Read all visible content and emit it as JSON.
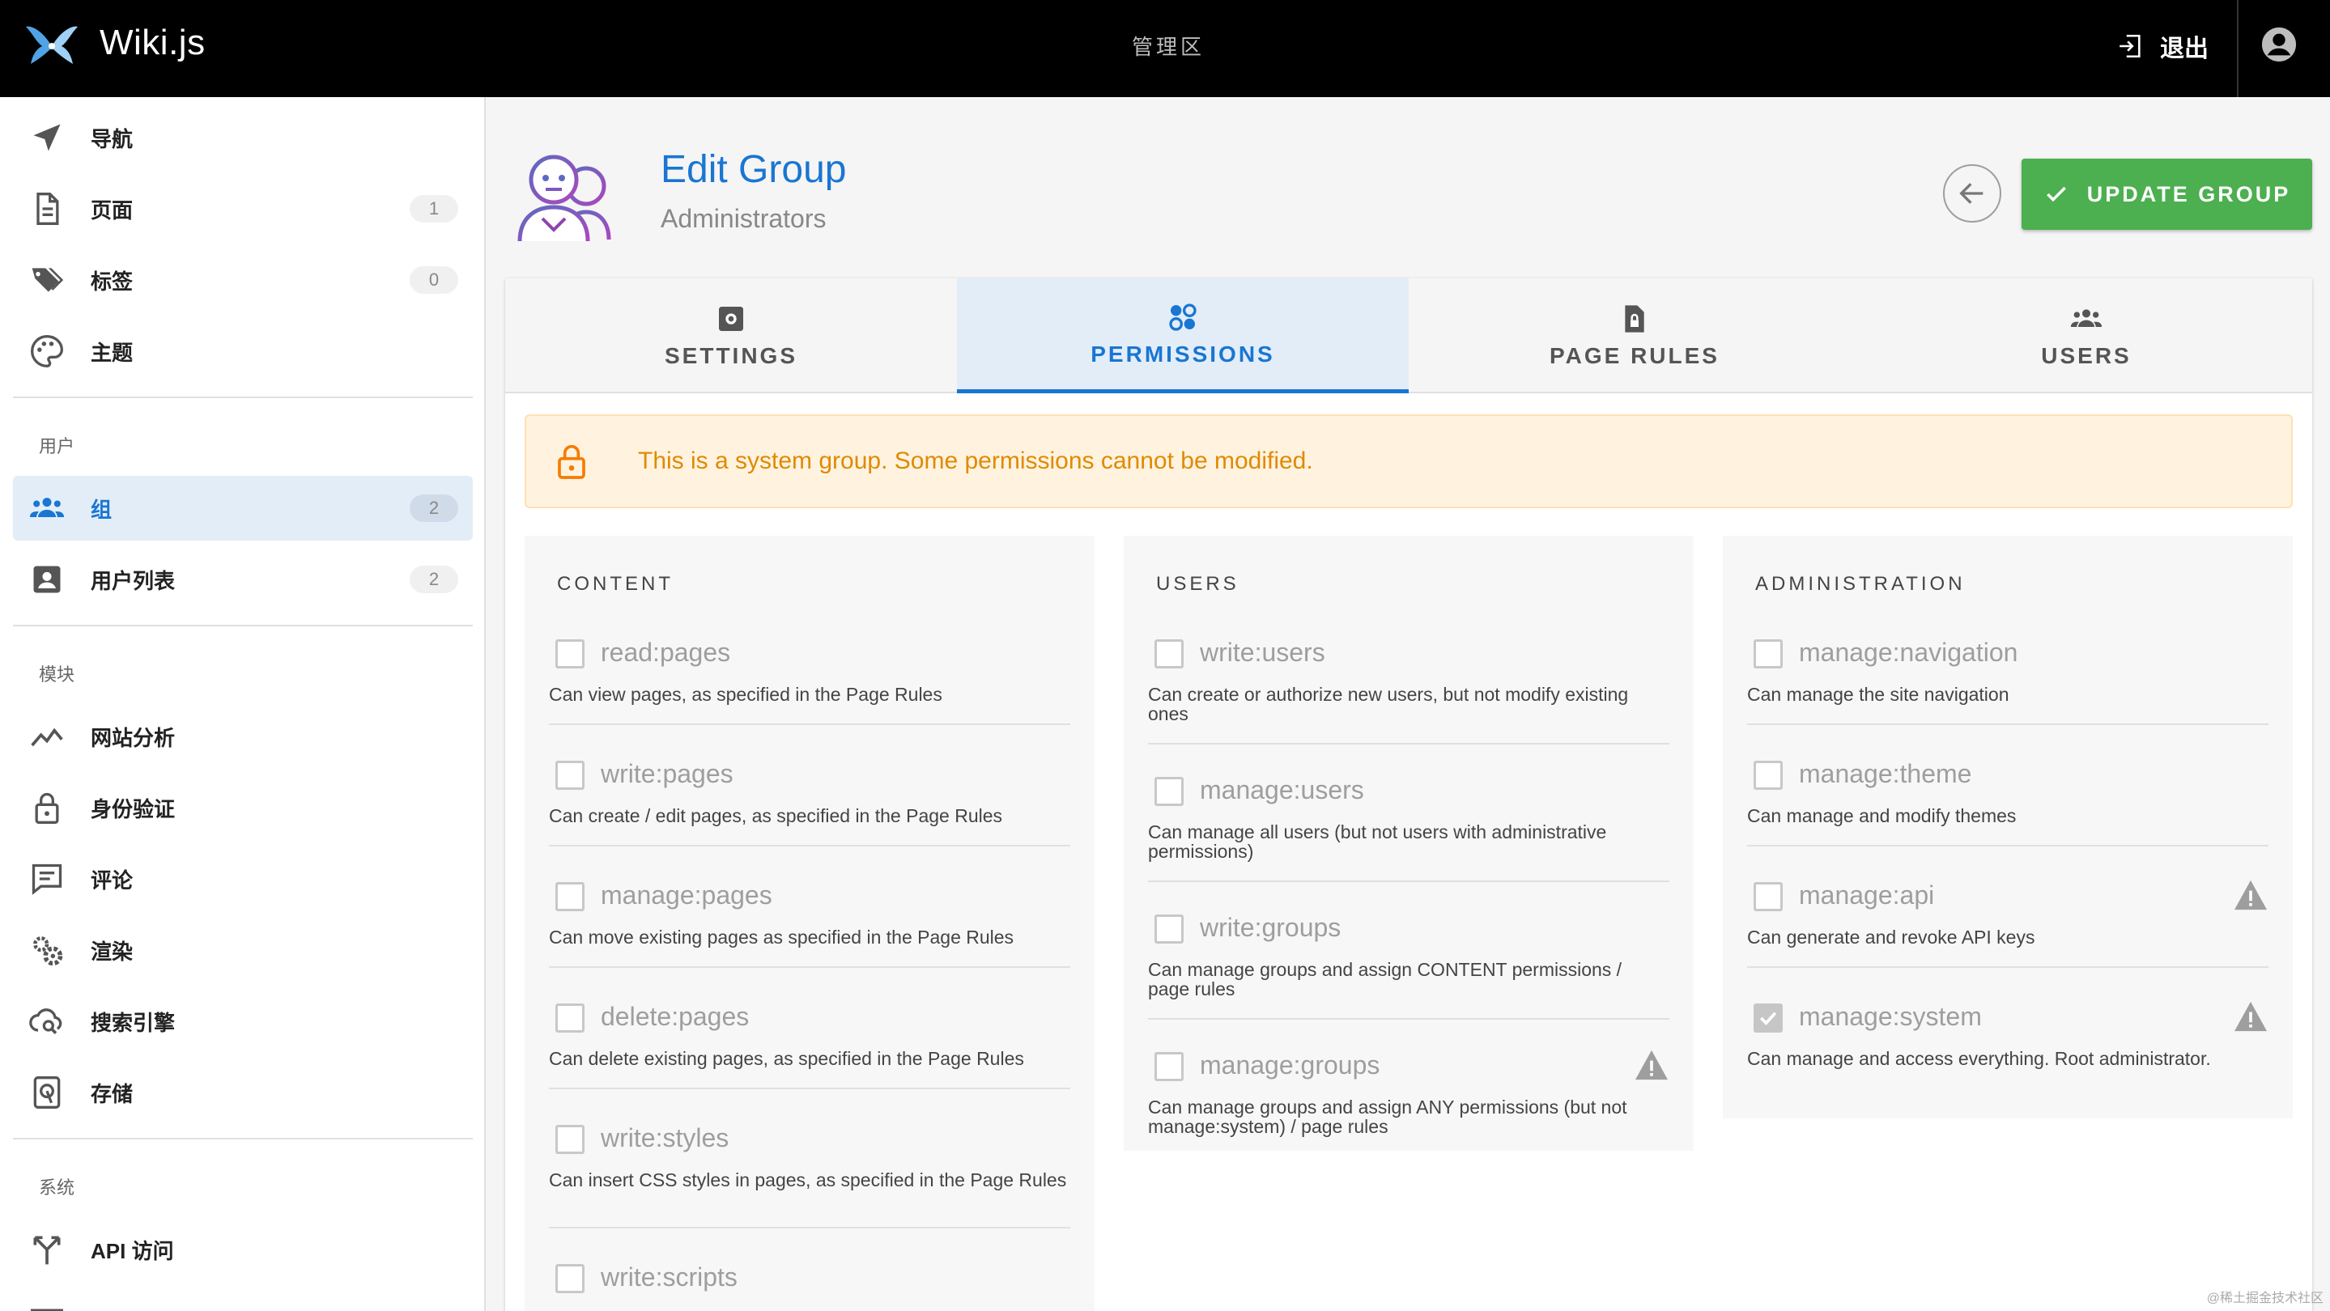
{
  "topbar": {
    "brand": "Wiki.js",
    "center": "管理区",
    "logout_label": "退出"
  },
  "sidebar": {
    "items_top": [
      {
        "label": "导航",
        "icon": "navigation-icon"
      },
      {
        "label": "页面",
        "icon": "file-icon",
        "badge": "1"
      },
      {
        "label": "标签",
        "icon": "tags-icon",
        "badge": "0"
      },
      {
        "label": "主题",
        "icon": "palette-icon"
      }
    ],
    "users_header": "用户",
    "users_items": [
      {
        "label": "组",
        "icon": "group-icon",
        "badge": "2",
        "active": true
      },
      {
        "label": "用户列表",
        "icon": "account-box-icon",
        "badge": "2"
      }
    ],
    "modules_header": "模块",
    "modules_items": [
      {
        "label": "网站分析",
        "icon": "analytics-icon"
      },
      {
        "label": "身份验证",
        "icon": "lock-icon"
      },
      {
        "label": "评论",
        "icon": "comment-icon"
      },
      {
        "label": "渲染",
        "icon": "cogs-icon"
      },
      {
        "label": "搜索引擎",
        "icon": "cloud-search-icon"
      },
      {
        "label": "存储",
        "icon": "storage-icon"
      }
    ],
    "system_header": "系统",
    "system_items": [
      {
        "label": "API 访问",
        "icon": "api-icon"
      }
    ]
  },
  "header": {
    "title": "Edit Group",
    "subtitle": "Administrators",
    "update_label": "UPDATE GROUP"
  },
  "tabs": [
    {
      "label": "SETTINGS",
      "icon": "settings-icon",
      "active": false
    },
    {
      "label": "PERMISSIONS",
      "icon": "permissions-icon",
      "active": true
    },
    {
      "label": "PAGE RULES",
      "icon": "page-lock-icon",
      "active": false
    },
    {
      "label": "USERS",
      "icon": "users-icon",
      "active": false
    }
  ],
  "alert": {
    "text": "This is a system group. Some permissions cannot be modified."
  },
  "columns": [
    {
      "title": "CONTENT",
      "perms": [
        {
          "name": "read:pages",
          "desc": "Can view pages, as specified in the Page Rules",
          "checked": false,
          "warn": false
        },
        {
          "name": "write:pages",
          "desc": "Can create / edit pages, as specified in the Page Rules",
          "checked": false,
          "warn": false
        },
        {
          "name": "manage:pages",
          "desc": "Can move existing pages as specified in the Page Rules",
          "checked": false,
          "warn": false
        },
        {
          "name": "delete:pages",
          "desc": "Can delete existing pages, as specified in the Page Rules",
          "checked": false,
          "warn": false
        },
        {
          "name": "write:styles",
          "desc": "Can insert CSS styles in pages, as specified in the Page Rules",
          "checked": false,
          "warn": false
        },
        {
          "name": "write:scripts",
          "desc": "",
          "checked": false,
          "warn": false
        }
      ]
    },
    {
      "title": "USERS",
      "perms": [
        {
          "name": "write:users",
          "desc": "Can create or authorize new users, but not modify existing ones",
          "checked": false,
          "warn": false
        },
        {
          "name": "manage:users",
          "desc": "Can manage all users (but not users with administrative permissions)",
          "checked": false,
          "warn": false
        },
        {
          "name": "write:groups",
          "desc": "Can manage groups and assign CONTENT permissions / page rules",
          "checked": false,
          "warn": false
        },
        {
          "name": "manage:groups",
          "desc": "Can manage groups and assign ANY permissions (but not manage:system) / page rules",
          "checked": false,
          "warn": true
        }
      ]
    },
    {
      "title": "ADMINISTRATION",
      "perms": [
        {
          "name": "manage:navigation",
          "desc": "Can manage the site navigation",
          "checked": false,
          "warn": false
        },
        {
          "name": "manage:theme",
          "desc": "Can manage and modify themes",
          "checked": false,
          "warn": false
        },
        {
          "name": "manage:api",
          "desc": "Can generate and revoke API keys",
          "checked": false,
          "warn": true
        },
        {
          "name": "manage:system",
          "desc": "Can manage and access everything. Root administrator.",
          "checked": true,
          "warn": true
        }
      ]
    }
  ],
  "watermark": "@稀土掘金技术社区",
  "colors": {
    "accent": "#1976d2",
    "update_button": "#4caf50",
    "alert_text": "#e08a00",
    "topbar": "#000000"
  }
}
